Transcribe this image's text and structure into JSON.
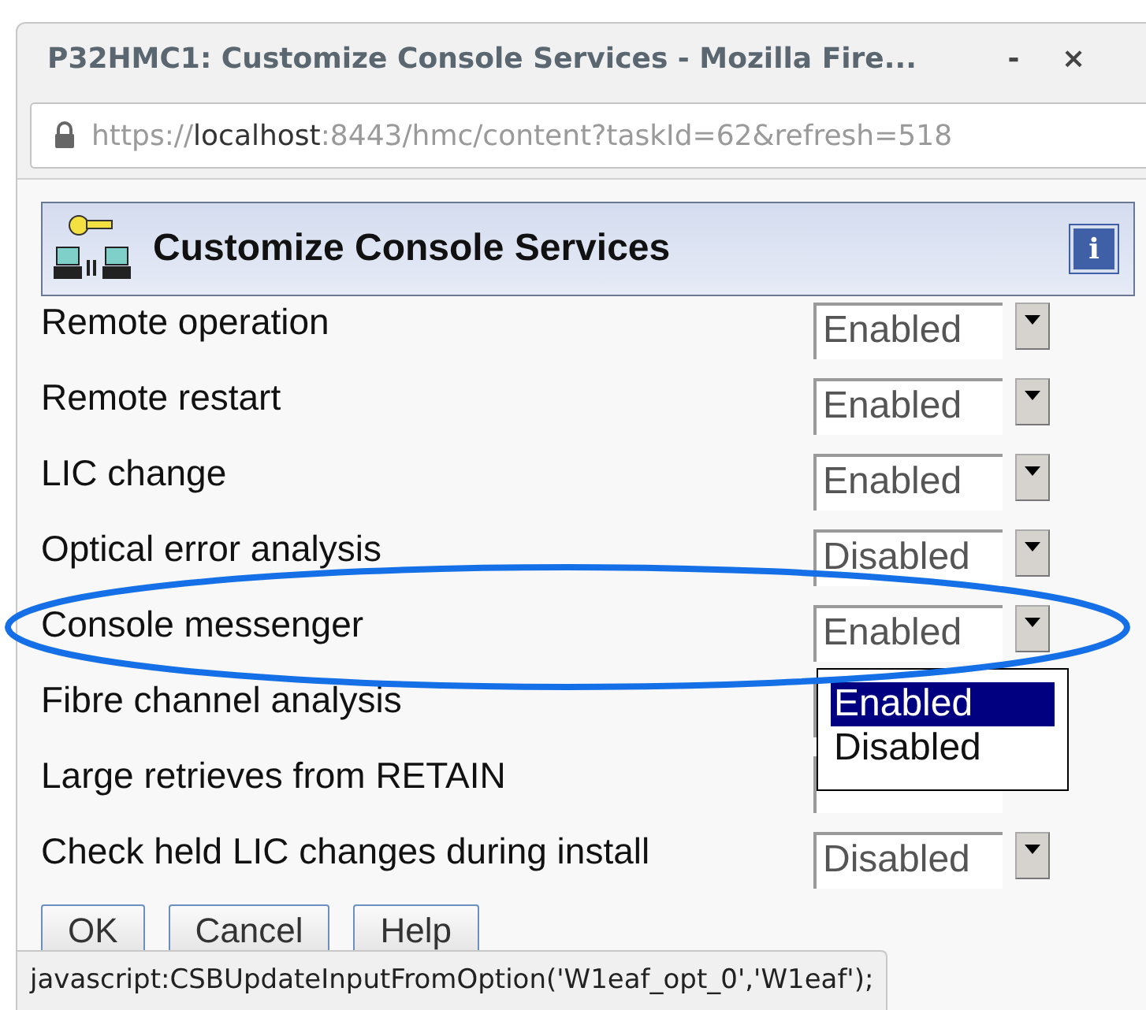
{
  "window": {
    "title": "P32HMC1: Customize Console Services - Mozilla Fire...",
    "controls": [
      "-",
      "×"
    ]
  },
  "address_bar": {
    "scheme": "https://",
    "host": "localhost",
    "rest": ":8443/hmc/content?taskId=62&refresh=518"
  },
  "panel": {
    "title": "Customize Console Services",
    "info": "i"
  },
  "services": [
    {
      "label": "Remote operation",
      "value": "Enabled"
    },
    {
      "label": "Remote restart",
      "value": "Enabled"
    },
    {
      "label": "LIC change",
      "value": "Enabled"
    },
    {
      "label": "Optical error analysis",
      "value": "Disabled"
    },
    {
      "label": "Console messenger",
      "value": "Enabled",
      "annotation": {
        "kind": "ellipse"
      },
      "options": [
        {
          "label": "Enabled",
          "selected": true
        },
        {
          "label": "Disabled",
          "selected": false
        }
      ]
    },
    {
      "label": "Fibre channel analysis"
    },
    {
      "label": "Large retrieves from RETAIN"
    },
    {
      "label": "Check held LIC changes during install",
      "value": "Disabled"
    }
  ],
  "buttons": [
    "OK",
    "Cancel",
    "Help"
  ],
  "status_text": "javascript:CSBUpdateInputFromOption('W1eaf_opt_0','W1eaf');"
}
